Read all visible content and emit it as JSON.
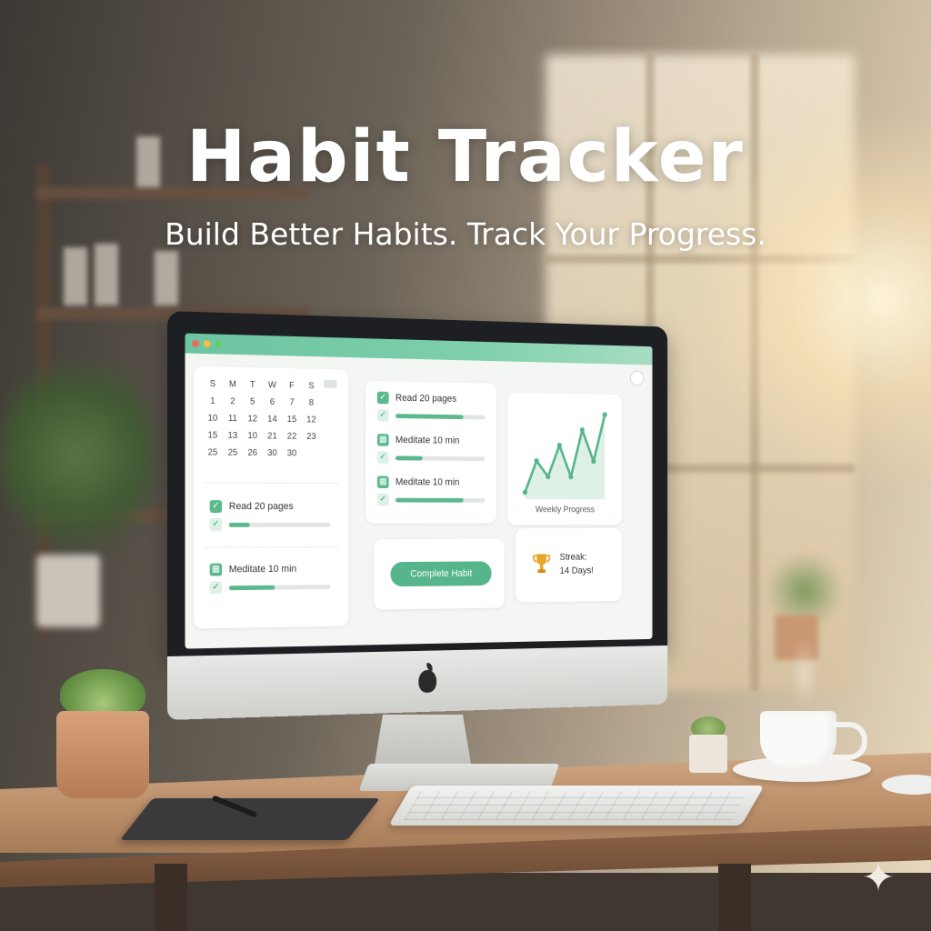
{
  "hero": {
    "title": "Habit Tracker",
    "subtitle": "Build Better Habits. Track Your Progress."
  },
  "calendar": {
    "weekdays": [
      "S",
      "M",
      "T",
      "W",
      "F",
      "S"
    ],
    "rows": [
      [
        "1",
        "2",
        "5",
        "6",
        "7",
        "8"
      ],
      [
        "10",
        "11",
        "12",
        "14",
        "15",
        "12"
      ],
      [
        "15",
        "13",
        "10",
        "21",
        "22",
        "23"
      ],
      [
        "25",
        "25",
        "26",
        "30",
        "30",
        ""
      ]
    ]
  },
  "left_habits": [
    {
      "name": "Read 20 pages",
      "progress": 0.2
    },
    {
      "name": "Meditate 10 min",
      "progress": 0.45
    }
  ],
  "middle_habits": [
    {
      "name": "Read 20 pages",
      "progress": 0.75
    },
    {
      "name": "Meditate 10 min",
      "progress": 0.3
    },
    {
      "name": "Meditate 10 min",
      "progress": 0.75
    }
  ],
  "progress_chart": {
    "label": "Weekly Progress",
    "values": [
      1,
      3,
      2,
      4,
      2,
      5,
      3,
      6
    ]
  },
  "actions": {
    "complete_label": "Complete Habit"
  },
  "streak": {
    "line1": "Streak:",
    "line2": "14 Days!"
  },
  "colors": {
    "accent": "#56b58a",
    "titlebar": "#6cc4a0",
    "traffic_red": "#ef6b5d",
    "traffic_yellow": "#f5c03c",
    "traffic_green": "#5fd068"
  }
}
